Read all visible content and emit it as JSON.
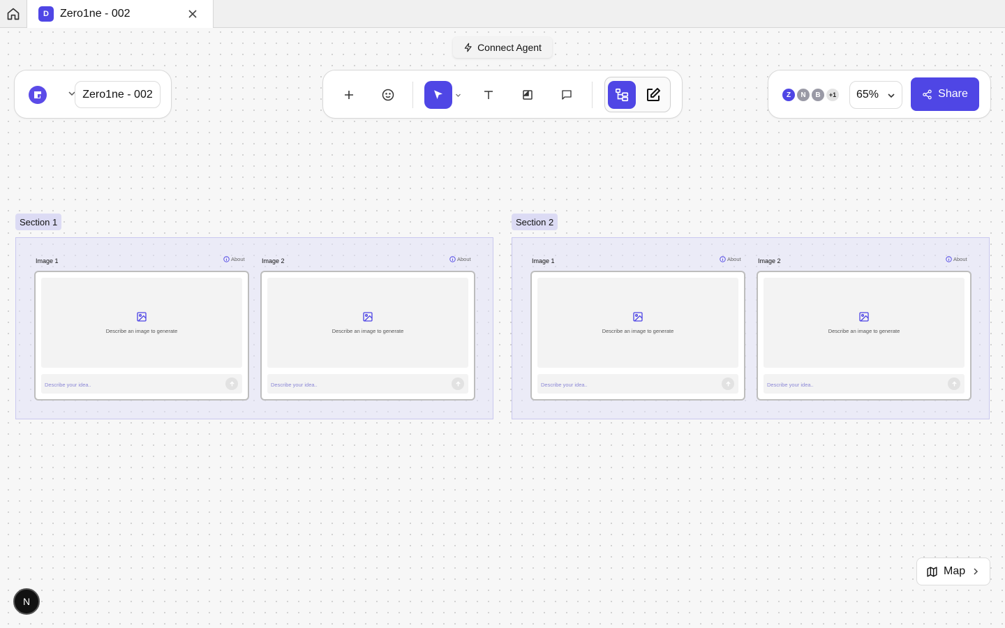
{
  "tab": {
    "badge": "D",
    "title": "Zero1ne - 002"
  },
  "connect_agent": {
    "label": "Connect Agent"
  },
  "project": {
    "name": "Zero1ne - 002"
  },
  "collaborators": {
    "avatars": [
      {
        "initial": "Z",
        "color": "#4f46e5"
      },
      {
        "initial": "N",
        "color": "#9a9aa6"
      },
      {
        "initial": "B",
        "color": "#9a9aa6"
      }
    ],
    "more": "+1"
  },
  "zoom": {
    "value": "65%"
  },
  "share": {
    "label": "Share"
  },
  "sections": [
    {
      "label": "Section 1",
      "cards": [
        {
          "title": "Image 1",
          "about": "About",
          "preview_text": "Describe an image to generate",
          "placeholder": "Describe your idea.."
        },
        {
          "title": "Image 2",
          "about": "About",
          "preview_text": "Describe an image to generate",
          "placeholder": "Describe your idea.."
        }
      ]
    },
    {
      "label": "Section 2",
      "cards": [
        {
          "title": "Image 1",
          "about": "About",
          "preview_text": "Describe an image to generate",
          "placeholder": "Describe your idea.."
        },
        {
          "title": "Image 2",
          "about": "About",
          "preview_text": "Describe an image to generate",
          "placeholder": "Describe your idea.."
        }
      ]
    }
  ],
  "map": {
    "label": "Map"
  },
  "user": {
    "initial": "N"
  },
  "colors": {
    "accent": "#4f46e5"
  }
}
